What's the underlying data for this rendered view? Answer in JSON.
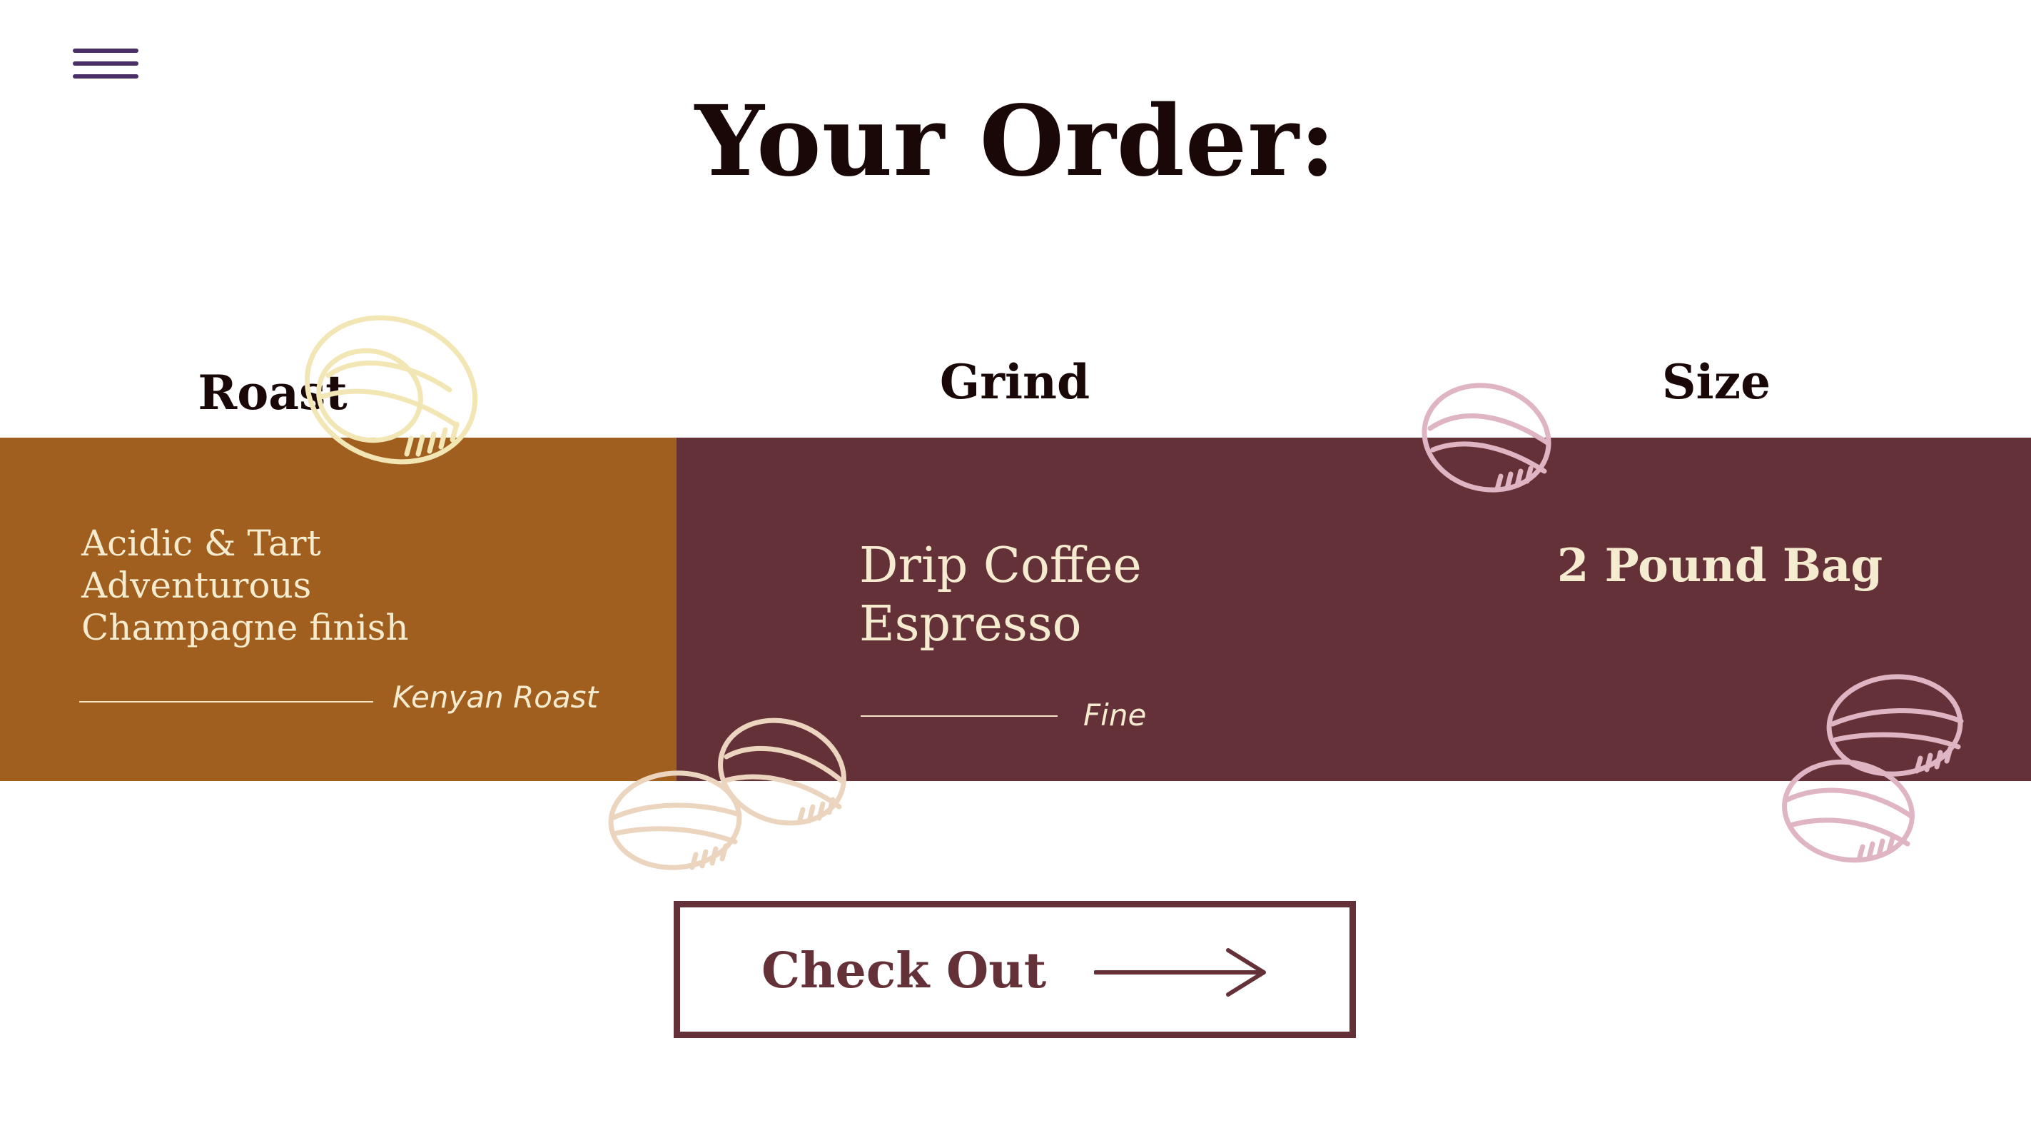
{
  "nav": {
    "menu_icon": "hamburger-menu-icon",
    "menu_color": "#4a2f66"
  },
  "page": {
    "title": "Your Order:"
  },
  "columns": {
    "roast": {
      "heading": "Roast",
      "notes": [
        "Acidic & Tart",
        "Adventurous",
        "Champagne finish"
      ],
      "caption": "Kenyan Roast",
      "panel_color": "#a05f1e"
    },
    "grind": {
      "heading": "Grind",
      "options": [
        "Drip Coffee",
        "Espresso"
      ],
      "caption": "Fine",
      "panel_color": "#653139"
    },
    "size": {
      "heading": "Size",
      "value": "2 Pound Bag"
    }
  },
  "checkout": {
    "label": "Check Out",
    "icon": "arrow-right-icon",
    "color": "#653139"
  },
  "decorations": {
    "icon": "coffee-bean-icon",
    "colors": {
      "cream": "#f3e6b5",
      "peach": "#ecd5bf",
      "pink": "#dfb5c3"
    }
  }
}
